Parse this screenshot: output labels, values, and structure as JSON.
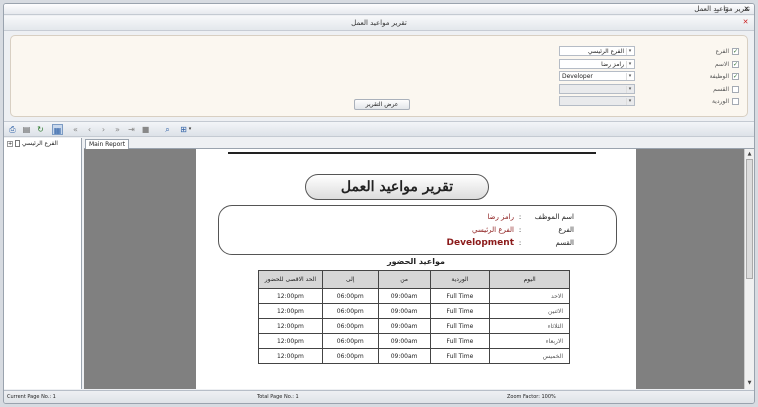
{
  "window": {
    "title": "تقرير مواعيد العمل"
  },
  "tab": {
    "title": "تقرير مواعيد العمل"
  },
  "filters": {
    "checks": [
      {
        "label": "الفرع",
        "checked": true
      },
      {
        "label": "الاسم",
        "checked": true
      },
      {
        "label": "الوظيفة",
        "checked": true
      },
      {
        "label": "القسم",
        "checked": false
      },
      {
        "label": "الوردية",
        "checked": false
      }
    ],
    "combos": [
      {
        "value": "الفرع الرئيسي",
        "enabled": true
      },
      {
        "value": "رامز رضا",
        "enabled": true
      },
      {
        "value": "Developer",
        "enabled": true
      },
      {
        "value": "",
        "enabled": false
      },
      {
        "value": "",
        "enabled": false
      }
    ],
    "show_button": "عرض التقرير"
  },
  "tree": {
    "root_label": "الفرع الرئيسي"
  },
  "report_tab": "Main Report",
  "report": {
    "title": "تقرير مواعيد العمل",
    "info": [
      {
        "label": "اسم الموظف",
        "value": "رامز رضا"
      },
      {
        "label": "الفرع",
        "value": "الفرع الرئيسي"
      },
      {
        "label": "القسم",
        "value": "Development"
      }
    ],
    "schedule_title": "مواعيد الحضور",
    "columns": [
      "اليوم",
      "الوردية",
      "من",
      "إلى",
      "الحد الاقصى للحضور"
    ],
    "rows": [
      [
        "الاحد",
        "Full Time",
        "09:00am",
        "06:00pm",
        "12:00pm"
      ],
      [
        "الاثنين",
        "Full Time",
        "09:00am",
        "06:00pm",
        "12:00pm"
      ],
      [
        "الثلاثاء",
        "Full Time",
        "09:00am",
        "06:00pm",
        "12:00pm"
      ],
      [
        "الاربعاء",
        "Full Time",
        "09:00am",
        "06:00pm",
        "12:00pm"
      ],
      [
        "الخميس",
        "Full Time",
        "09:00am",
        "06:00pm",
        "12:00pm"
      ]
    ]
  },
  "status": {
    "current_page": "Current Page No.: 1",
    "total_page": "Total Page No.: 1",
    "zoom": "Zoom Factor: 100%"
  }
}
